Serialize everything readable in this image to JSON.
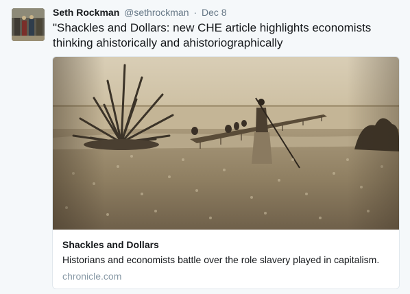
{
  "tweet": {
    "fullname": "Seth Rockman",
    "handle": "@sethrockman",
    "separator": "·",
    "time": "Dec 8",
    "text": "\"Shackles and Dollars: new CHE article highlights economists thinking ahistorically and ahistoriographically"
  },
  "card": {
    "title": "Shackles and Dollars",
    "description": "Historians and economists battle over the role slavery played in capitalism.",
    "domain": "chronicle.com"
  },
  "colors": {
    "background": "#f5f8fa",
    "secondary_text": "#657786",
    "domain_text": "#8899a6",
    "card_border": "#e1e8ed",
    "photo_sepia": "#a8987a"
  }
}
